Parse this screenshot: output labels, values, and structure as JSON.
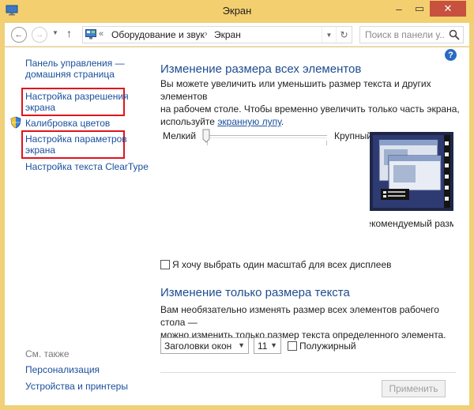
{
  "window": {
    "title": "Экран"
  },
  "nav": {
    "breadcrumb_prefix": "«",
    "crumbs": [
      "Оборудование и звук",
      "Экран"
    ],
    "crumb_sep": "›",
    "search_placeholder": "Поиск в панели у..."
  },
  "sidebar": {
    "home_link_line1": "Панель управления —",
    "home_link_line2": "домашняя страница",
    "items": [
      {
        "line1": "Настройка разрешения",
        "line2": "экрана"
      },
      {
        "line1": "Калибровка цветов"
      },
      {
        "line1": "Настройка параметров",
        "line2": "экрана"
      },
      {
        "line1": "Настройка текста ClearType"
      }
    ],
    "see_also_label": "См. также",
    "see_also": [
      "Персонализация",
      "Устройства и принтеры"
    ]
  },
  "main": {
    "section1_title": "Изменение размера всех элементов",
    "section1_text_line1": "Вы можете увеличить или уменьшить размер текста и других элементов",
    "section1_text_line2": "на рабочем столе. Чтобы временно увеличить только часть экрана,",
    "section1_text_line3_prefix": "используйте ",
    "section1_link": "экранную лупу",
    "section1_text_line3_suffix": ".",
    "slider_min_label": "Мелкий",
    "slider_max_label": "Крупный",
    "slider_value": 0,
    "preview_caption": "Рекомендуемый размер",
    "checkbox_label": "Я хочу выбрать один масштаб для всех дисплеев",
    "checkbox_checked": false,
    "section2_title": "Изменение только размера текста",
    "section2_text_line1": "Вам необязательно изменять размер всех элементов рабочего стола —",
    "section2_text_line2": "можно изменить только размер текста определенного элемента.",
    "element_select_value": "Заголовки окон",
    "size_select_value": "11",
    "bold_label": "Полужирный",
    "bold_checked": false,
    "apply_label": "Применить"
  },
  "colors": {
    "title_bar": "#f3cf6f",
    "link": "#1a4f9c",
    "heading": "#1e4c8f",
    "highlight_box": "#e0141c",
    "close_button": "#c7503f"
  }
}
